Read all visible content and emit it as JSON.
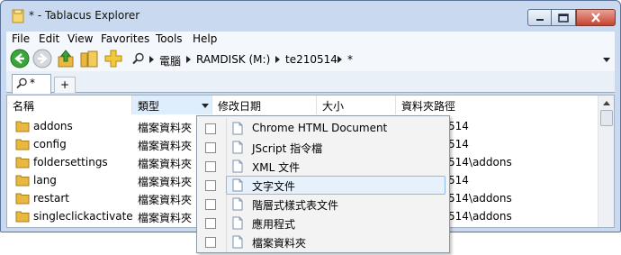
{
  "window": {
    "title": "* - Tablacus Explorer"
  },
  "menubar": [
    "File",
    "Edit",
    "View",
    "Favorites",
    "Tools",
    "Help"
  ],
  "address": {
    "segments": [
      "電腦",
      "RAMDISK (M:)",
      "te210514",
      "*"
    ]
  },
  "tabs": [
    {
      "label": "*"
    }
  ],
  "tab_add_label": "+",
  "columns": {
    "name": "名稱",
    "type": "類型",
    "modified": "修改日期",
    "size": "大小",
    "folder_path": "資料夾路徑"
  },
  "rows": [
    {
      "name": "addons",
      "type": "檔案資料夾",
      "path": "514"
    },
    {
      "name": "config",
      "type": "檔案資料夾",
      "path": "514"
    },
    {
      "name": "foldersettings",
      "type": "檔案資料夾",
      "path": "514\\addons"
    },
    {
      "name": "lang",
      "type": "檔案資料夾",
      "path": "514"
    },
    {
      "name": "restart",
      "type": "檔案資料夾",
      "path": "514\\addons"
    },
    {
      "name": "singleclickactivate",
      "type": "檔案資料夾",
      "path": "514\\addons"
    }
  ],
  "filter_menu": {
    "items": [
      {
        "label": "Chrome HTML Document",
        "checked": false
      },
      {
        "label": "JScript 指令檔",
        "checked": false
      },
      {
        "label": "XML 文件",
        "checked": false
      },
      {
        "label": "文字文件",
        "checked": false,
        "highlighted": true
      },
      {
        "label": "階層式樣式表文件",
        "checked": false
      },
      {
        "label": "應用程式",
        "checked": false
      },
      {
        "label": "檔案資料夾",
        "checked": false
      }
    ]
  },
  "colors": {
    "chrome": "#c9daf0",
    "folder": "#e8b840",
    "close": "#c7422e",
    "highlight": "#e7f1fc"
  }
}
